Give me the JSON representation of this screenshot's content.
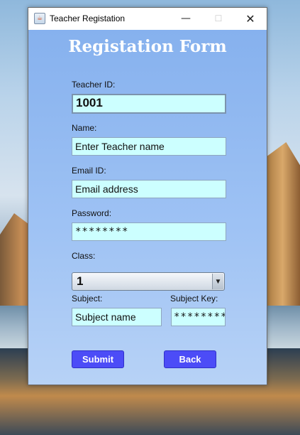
{
  "window": {
    "title": "Teacher Registation",
    "minimize_glyph": "—",
    "maximize_glyph": "☐",
    "close_glyph": "✕",
    "app_icon": "java-icon"
  },
  "form": {
    "title": "Registation Form",
    "teacher_id": {
      "label": "Teacher ID:",
      "value": "1001"
    },
    "name": {
      "label": "Name:",
      "value": "Enter Teacher name"
    },
    "email": {
      "label": "Email ID:",
      "value": "Email address"
    },
    "password": {
      "label": "Password:",
      "value": "********"
    },
    "class": {
      "label": "Class:",
      "selected": "1"
    },
    "subject": {
      "label": "Subject:",
      "value": "Subject name"
    },
    "subject_key": {
      "label": "Subject Key:",
      "value": "********"
    },
    "submit_label": "Submit",
    "back_label": "Back"
  },
  "colors": {
    "field_bg": "#ccffff",
    "button_bg": "#4c4cf7",
    "panel_top": "#86b1ee",
    "panel_bottom": "#b7d2f6"
  }
}
